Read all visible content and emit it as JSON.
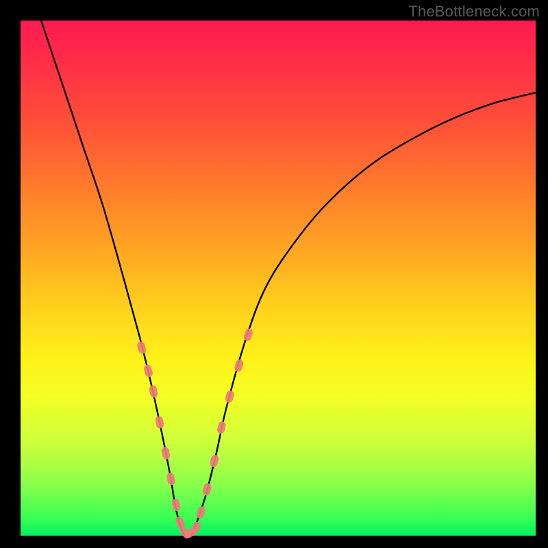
{
  "watermark": "TheBottleneck.com",
  "colors": {
    "frame": "#000000",
    "curve": "#000000",
    "marker_fill": "#ef7a79",
    "marker_stroke": "#c95a58",
    "gradient_top": "#ff1a52",
    "gradient_bottom": "#00f060"
  },
  "chart_data": {
    "type": "line",
    "title": "",
    "xlabel": "",
    "ylabel": "",
    "xlim": [
      0,
      100
    ],
    "ylim": [
      0,
      100
    ],
    "note": "Axes are unlabeled in the image; values are estimated as percentages of the plot area, y=0 at bottom (green), y=100 at top (red).",
    "series": [
      {
        "name": "curve",
        "x": [
          4,
          8,
          12,
          16,
          20,
          23,
          25,
          27,
          29,
          30,
          31,
          32,
          33,
          34,
          36,
          38,
          40,
          44,
          48,
          54,
          60,
          68,
          76,
          84,
          92,
          100
        ],
        "y": [
          100,
          88,
          76,
          64,
          50,
          39,
          31,
          22,
          12,
          6,
          2,
          0,
          0,
          2,
          8,
          16,
          25,
          39,
          49,
          58,
          65,
          72,
          77,
          81,
          84,
          86
        ]
      }
    ],
    "markers": {
      "name": "salmon-dots",
      "note": "Short dashed salmon segments overlaid on both flanks near the valley.",
      "x": [
        23.5,
        24.8,
        25.8,
        27.0,
        28.2,
        29.2,
        30.2,
        31.0,
        32.0,
        33.0,
        34.0,
        35.0,
        36.2,
        37.6,
        39.0,
        40.6,
        42.4,
        44.2
      ],
      "y": [
        36.5,
        32.0,
        28.0,
        22.0,
        16.0,
        11.0,
        6.0,
        2.5,
        0.5,
        0.5,
        1.5,
        4.5,
        9.0,
        14.5,
        21.0,
        27.0,
        33.0,
        39.0
      ]
    }
  }
}
